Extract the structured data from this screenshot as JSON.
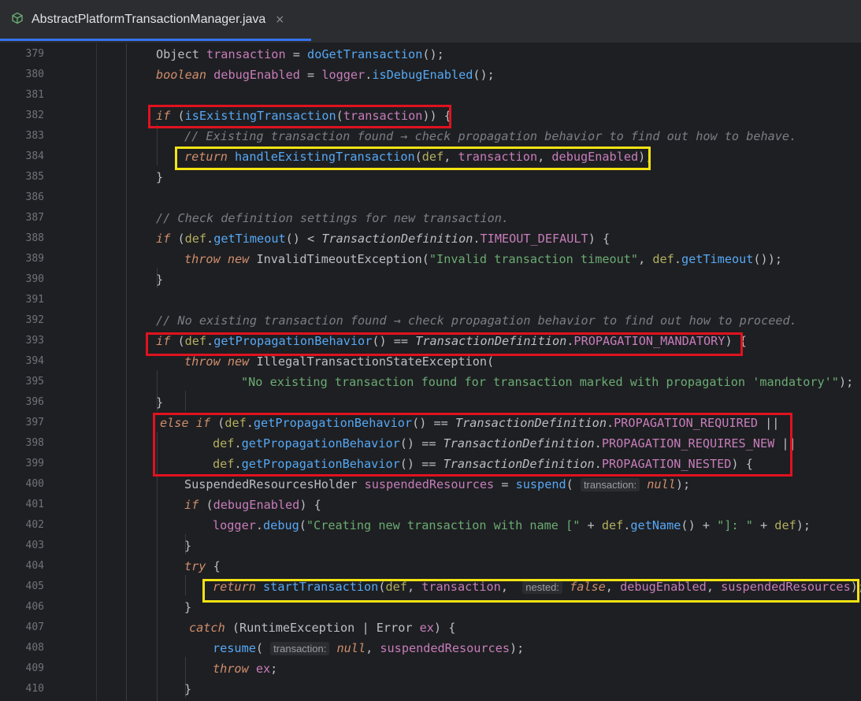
{
  "tab": {
    "title": "AbstractPlatformTransactionManager.java",
    "close": "×",
    "icon": "java-class-icon"
  },
  "colors": {
    "red_box": "#e0121f",
    "yellow_box": "#f2e313",
    "accent": "#3574f0"
  },
  "lines": {
    "379": "379",
    "380": "380",
    "381": "381",
    "382": "382",
    "383": "383",
    "384": "384",
    "385": "385",
    "386": "386",
    "387": "387",
    "388": "388",
    "389": "389",
    "390": "390",
    "391": "391",
    "392": "392",
    "393": "393",
    "394": "394",
    "395": "395",
    "396": "396",
    "397": "397",
    "398": "398",
    "399": "399",
    "400": "400",
    "401": "401",
    "402": "402",
    "403": "403",
    "404": "404",
    "405": "405",
    "406": "406",
    "407": "407",
    "408": "408",
    "409": "409",
    "410": "410"
  },
  "code": {
    "l379": {
      "a": "Object",
      "b": " transaction",
      "c": " = ",
      "d": "doGetTransaction",
      "e": "();"
    },
    "l380": {
      "a": "boolean",
      "b": " debugEnabled",
      "c": " = ",
      "d": "logger",
      "e": ".",
      "f": "isDebugEnabled",
      "g": "();"
    },
    "l382": {
      "a": "if",
      "b": " (",
      "c": "isExistingTransaction",
      "d": "(",
      "e": "transaction",
      "f": ")) {"
    },
    "l383": {
      "a": "// Existing transaction found → check propagation behavior to find out how to behave."
    },
    "l384": {
      "a": "return",
      "b": " ",
      "c": "handleExistingTransaction",
      "d": "(",
      "e": "def",
      "f": ", ",
      "g": "transaction",
      "h": ", ",
      "i": "debugEnabled",
      "j": ");"
    },
    "l385": {
      "a": "}"
    },
    "l387": {
      "a": "// Check definition settings for new transaction."
    },
    "l388": {
      "a": "if",
      "b": " (",
      "c": "def",
      "d": ".",
      "e": "getTimeout",
      "f": "() < ",
      "g": "TransactionDefinition",
      "h": ".",
      "i": "TIMEOUT_DEFAULT",
      "j": ") {"
    },
    "l389": {
      "a": "throw",
      "b": " ",
      "c": "new",
      "d": " InvalidTimeoutException(",
      "e": "\"Invalid transaction timeout\"",
      "f": ", ",
      "g": "def",
      "h": ".",
      "i": "getTimeout",
      "j": "());"
    },
    "l390": {
      "a": "}"
    },
    "l392": {
      "a": "// No existing transaction found → check propagation behavior to find out how to proceed."
    },
    "l393": {
      "a": "if",
      "b": " (",
      "c": "def",
      "d": ".",
      "e": "getPropagationBehavior",
      "f": "() == ",
      "g": "TransactionDefinition",
      "h": ".",
      "i": "PROPAGATION_MANDATORY",
      "j": ") {"
    },
    "l394": {
      "a": "throw",
      "b": " ",
      "c": "new",
      "d": " IllegalTransactionStateException("
    },
    "l395": {
      "a": "\"No existing transaction found for transaction marked with propagation 'mandatory'\"",
      "b": ");"
    },
    "l396": {
      "a": "}"
    },
    "l397": {
      "a": "else if",
      "b": " (",
      "c": "def",
      "d": ".",
      "e": "getPropagationBehavior",
      "f": "() == ",
      "g": "TransactionDefinition",
      "h": ".",
      "i": "PROPAGATION_REQUIRED",
      "j": " ||"
    },
    "l398": {
      "c": "def",
      "d": ".",
      "e": "getPropagationBehavior",
      "f": "() == ",
      "g": "TransactionDefinition",
      "h": ".",
      "i": "PROPAGATION_REQUIRES_NEW",
      "j": " ||"
    },
    "l399": {
      "c": "def",
      "d": ".",
      "e": "getPropagationBehavior",
      "f": "() == ",
      "g": "TransactionDefinition",
      "h": ".",
      "i": "PROPAGATION_NESTED",
      "j": ") {"
    },
    "l400": {
      "a": "SuspendedResourcesHolder",
      "b": " suspendedResources",
      "c": " = ",
      "d": "suspend",
      "e": "( ",
      "f": "transaction:",
      "g": " null",
      "h": ");"
    },
    "l401": {
      "a": "if",
      "b": " (",
      "c": "debugEnabled",
      "d": ") {"
    },
    "l402": {
      "a": "logger",
      "b": ".",
      "c": "debug",
      "d": "(",
      "e": "\"Creating new transaction with name [\"",
      "f": " + ",
      "g": "def",
      "h": ".",
      "i": "getName",
      "j": "() + ",
      "k": "\"]: \"",
      "l": " + ",
      "m": "def",
      "n": ");"
    },
    "l403": {
      "a": "}"
    },
    "l404": {
      "a": "try",
      "b": " {"
    },
    "l405": {
      "a": "return",
      "b": " ",
      "c": "startTransaction",
      "d": "(",
      "e": "def",
      "f": ", ",
      "g": "transaction",
      "h": ",  ",
      "i": "nested:",
      "j": " false",
      "k": ", ",
      "l": "debugEnabled",
      "m": ", ",
      "n": "suspendedResources",
      "o": ");"
    },
    "l406": {
      "a": "}"
    },
    "l407": {
      "a": "catch",
      "b": " (",
      "c": "RuntimeException",
      "d": " | ",
      "e": "Error",
      "f": " ex",
      "g": ") {"
    },
    "l408": {
      "a": "resume",
      "b": "( ",
      "c": "transaction:",
      "d": " null",
      "e": ", ",
      "f": "suspendedResources",
      "g": ");"
    },
    "l409": {
      "a": "throw",
      "b": " ",
      "c": "ex",
      "d": ";"
    },
    "l410": {
      "a": "}"
    }
  }
}
